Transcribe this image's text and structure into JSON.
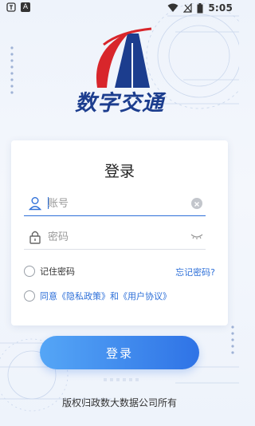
{
  "status_bar": {
    "left_text": "A",
    "time": "5:05"
  },
  "logo": {
    "app_name": "数字交通"
  },
  "login_card": {
    "title": "登录",
    "account_placeholder": "账号",
    "password_placeholder": "密码",
    "remember_label": "记住密码",
    "forgot_label": "忘记密码?",
    "agree_label": "同意《隐私政策》和《用户协议》"
  },
  "login_button": {
    "label": "登录"
  },
  "footer": {
    "copyright": "版权归政数大数据公司所有"
  },
  "colors": {
    "accent": "#2d6fd8",
    "brand": "#1c3d8e",
    "logo_red": "#d8262b",
    "button_gradient_start": "#55a6f6",
    "button_gradient_end": "#2f73e6"
  },
  "icons": {
    "status_left": [
      "app-notification-icon",
      "a-icon"
    ],
    "status_right": [
      "wifi-icon",
      "no-signal-icon",
      "battery-icon"
    ],
    "account_field": "user-icon",
    "password_field": "lock-icon",
    "clear": "clear-icon",
    "password_visibility": "eye-closed-icon"
  }
}
